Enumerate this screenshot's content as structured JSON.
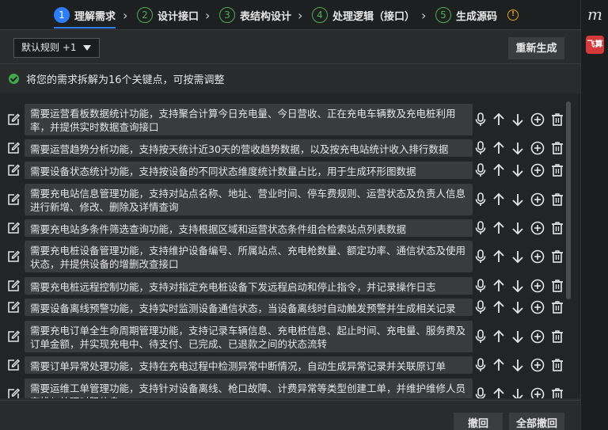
{
  "steps": [
    {
      "num": "1",
      "label": "理解需求"
    },
    {
      "num": "2",
      "label": "设计接口"
    },
    {
      "num": "3",
      "label": "表结构设计"
    },
    {
      "num": "4",
      "label": "处理逻辑（接口）"
    },
    {
      "num": "5",
      "label": "生成源码"
    }
  ],
  "rightbar": {
    "logo": "m",
    "badge": "飞算"
  },
  "toolbar": {
    "rule_select": "默认规则 +1",
    "regenerate_label": "重新生成"
  },
  "notice": {
    "text": "将您的需求拆解为16个关键点，可按需调整"
  },
  "requirements": [
    "需要运营看板数据统计功能，支持聚合计算今日充电量、今日营收、正在充电车辆数及充电桩利用率，并提供实时数据查询接口",
    "需要运营趋势分析功能，支持按天统计近30天的营收趋势数据，以及按充电站统计收入排行数据",
    "需要设备状态统计功能，支持按设备的不同状态维度统计数量占比，用于生成环形图数据",
    "需要充电站信息管理功能，支持对站点名称、地址、营业时间、停车费规则、运营状态及负责人信息进行新增、修改、删除及详情查询",
    "需要充电站多条件筛选查询功能，支持根据区域和运营状态条件组合检索站点列表数据",
    "需要充电桩设备管理功能，支持维护设备编号、所属站点、充电枪数量、额定功率、通信状态及使用状态，并提供设备的增删改查接口",
    "需要充电桩远程控制功能，支持对指定充电桩设备下发远程启动和停止指令，并记录操作日志",
    "需要设备离线预警功能，支持实时监测设备通信状态，当设备离线时自动触发预警并生成相关记录",
    "需要充电订单全生命周期管理功能，支持记录车辆信息、充电桩信息、起止时间、充电量、服务费及订单金额，并实现充电中、待支付、已完成、已退款之间的状态流转",
    "需要订单异常处理功能，支持在充电过程中检测异常中断情况，自动生成异常记录并关联原订单",
    "需要运维工单管理功能，支持针对设备离线、枪口故障、计费异常等类型创建工单，并维护维修人员安排与处理时限信息"
  ],
  "footer": {
    "undo_label": "撤回",
    "undo_all_label": "全部撤回"
  },
  "colors": {
    "accent": "#2d7ff9",
    "step_done": "#4caf50",
    "success": "#3ea84a",
    "warning": "#e0a020"
  }
}
